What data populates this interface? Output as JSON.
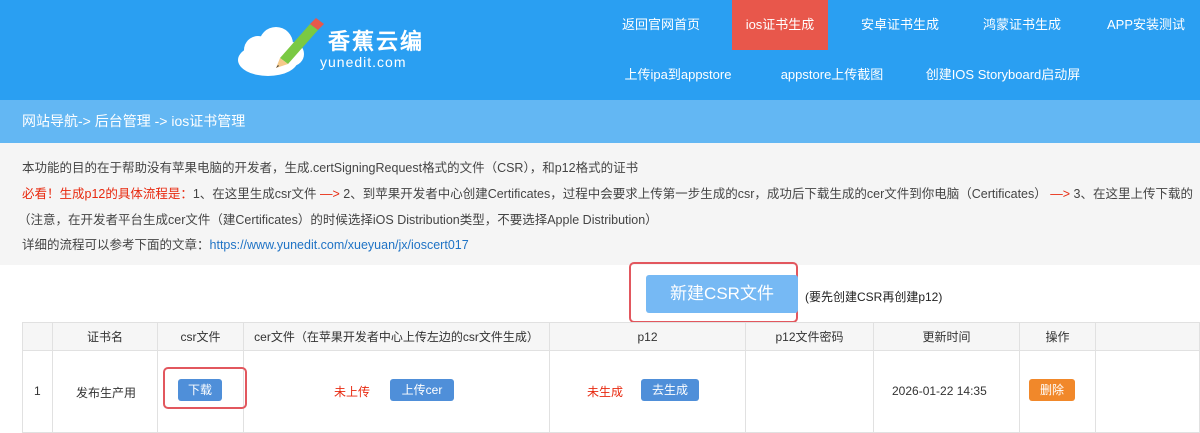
{
  "header": {
    "logo_title": "香蕉云编",
    "logo_subtitle": "yunedit.com",
    "nav_row1": [
      "返回官网首页",
      "ios证书生成",
      "安卓证书生成",
      "鸿蒙证书生成",
      "APP安装测试"
    ],
    "nav_row2": [
      "上传ipa到appstore",
      "appstore上传截图",
      "创建IOS Storyboard启动屏"
    ],
    "active_item": "ios证书生成",
    "colors": {
      "header_bg": "#2a9ff2",
      "active_bg": "#e8574b",
      "crumb_bg": "#63b7f3"
    }
  },
  "breadcrumb": "网站导航-> 后台管理 -> ios证书管理",
  "description": {
    "line1": "本功能的目的在于帮助没有苹果电脑的开发者，生成.certSigningRequest格式的文件（CSR），和p12格式的证书",
    "line2_prefix": "必看！生成p12的具体流程是：",
    "line2_step1": "1、在这里生成csr文件 ",
    "arrow": "—>",
    "line2_step2": " 2、到苹果开发者中心创建Certificates，过程中会要求上传第一步生成的csr，成功后下载生成的cer文件到你电脑（Certificates） ",
    "line2_step3": " 3、在这里上传下载的",
    "line3": "（注意，在开发者平台生成cer文件（建Certificates）的时候选择iOS Distribution类型，不要选择Apple Distribution）",
    "line4_prefix": "详细的流程可以参考下面的文章：",
    "line4_link": "https://www.yunedit.com/xueyuan/jx/ioscert017"
  },
  "csr": {
    "button_label": "新建CSR文件",
    "note": "(要先创建CSR再创建p12)"
  },
  "table": {
    "headers": [
      "证书名",
      "csr文件",
      "cer文件（在苹果开发者中心上传左边的csr文件生成）",
      "p12",
      "p12文件密码",
      "更新时间",
      "操作"
    ],
    "rows": [
      {
        "index": "1",
        "name": "发布生产用",
        "csr_button": "下载",
        "cer_status": "未上传",
        "cer_button": "上传cer",
        "p12_status": "未生成",
        "p12_button": "去生成",
        "p12_password": "",
        "updated_at": "2026-01-22 14:35",
        "delete_button": "删除"
      }
    ]
  }
}
